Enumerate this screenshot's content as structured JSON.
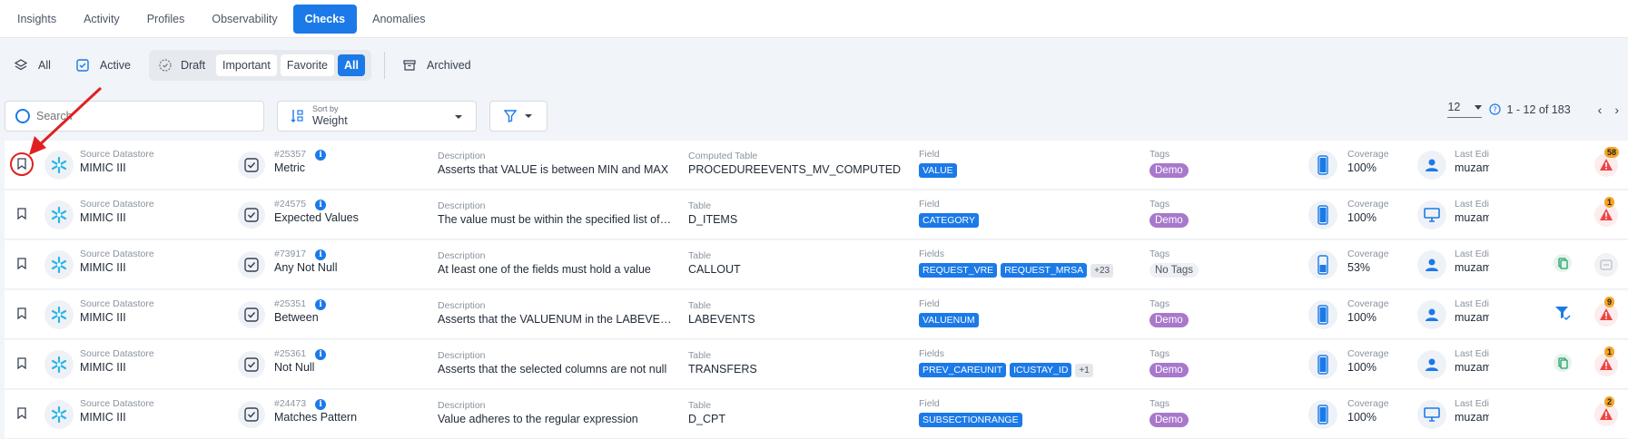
{
  "tabs": [
    {
      "label": "Insights"
    },
    {
      "label": "Activity"
    },
    {
      "label": "Profiles"
    },
    {
      "label": "Observability"
    },
    {
      "label": "Checks",
      "active": true
    },
    {
      "label": "Anomalies"
    }
  ],
  "filters": {
    "all": "All",
    "active": "Active",
    "draft": "Draft",
    "important": "Important",
    "favorite": "Favorite",
    "all_pill": "All",
    "archived": "Archived"
  },
  "search": {
    "placeholder": "Search"
  },
  "sort": {
    "label": "Sort by",
    "value": "Weight"
  },
  "pager": {
    "per_page": "12",
    "range": "1 - 12 of 183"
  },
  "columns": {
    "source": "Source Datastore",
    "description": "Description",
    "tags": "Tags",
    "coverage": "Coverage",
    "last_edit": "Last Edit"
  },
  "rows": [
    {
      "ds": "MIMIC III",
      "id": "#25357",
      "rule": "Metric",
      "desc": "Asserts that VALUE is between MIN and MAX",
      "tbl_label": "Computed Table",
      "tbl": "PROCEDUREEVENTS_MV_COMPUTED",
      "field_label": "Field",
      "fields": [
        "VALUE"
      ],
      "more": "",
      "tag": "Demo",
      "coverage": "100%",
      "coverage_level": 1.0,
      "editor": "muzam",
      "alert_count": "58",
      "alert_type": "warning",
      "editor_icon": "user-icon"
    },
    {
      "ds": "MIMIC III",
      "id": "#24575",
      "rule": "Expected Values",
      "desc": "The value must be within the specified list of values",
      "tbl_label": "Table",
      "tbl": "D_ITEMS",
      "field_label": "Field",
      "fields": [
        "CATEGORY"
      ],
      "more": "",
      "tag": "Demo",
      "coverage": "100%",
      "coverage_level": 1.0,
      "editor": "muzam",
      "alert_count": "1",
      "alert_type": "warning",
      "editor_icon": "monitor-icon"
    },
    {
      "ds": "MIMIC III",
      "id": "#73917",
      "rule": "Any Not Null",
      "desc": "At least one of the fields must hold a value",
      "tbl_label": "Table",
      "tbl": "CALLOUT",
      "field_label": "Fields",
      "fields": [
        "REQUEST_VRE",
        "REQUEST_MRSA"
      ],
      "more": "+23",
      "tag": "No Tags",
      "coverage": "53%",
      "coverage_level": 0.53,
      "editor": "muzam",
      "alert_count": "",
      "alert_type": "none",
      "editor_icon": "user-icon"
    },
    {
      "ds": "MIMIC III",
      "id": "#25351",
      "rule": "Between",
      "desc": "Asserts that the VALUENUM in the LABEVENTS table is within range",
      "tbl_label": "Table",
      "tbl": "LABEVENTS",
      "field_label": "Field",
      "fields": [
        "VALUENUM"
      ],
      "more": "",
      "tag": "Demo",
      "coverage": "100%",
      "coverage_level": 1.0,
      "editor": "muzam",
      "alert_count": "9",
      "alert_type": "warning",
      "editor_icon": "user-icon"
    },
    {
      "ds": "MIMIC III",
      "id": "#25361",
      "rule": "Not Null",
      "desc": "Asserts that the selected columns are not null",
      "tbl_label": "Table",
      "tbl": "TRANSFERS",
      "field_label": "Fields",
      "fields": [
        "PREV_CAREUNIT",
        "ICUSTAY_ID"
      ],
      "more": "+1",
      "tag": "Demo",
      "coverage": "100%",
      "coverage_level": 1.0,
      "editor": "muzam",
      "alert_count": "1",
      "alert_type": "warning",
      "editor_icon": "user-icon"
    },
    {
      "ds": "MIMIC III",
      "id": "#24473",
      "rule": "Matches Pattern",
      "desc": "Value adheres to the regular expression",
      "tbl_label": "Table",
      "tbl": "D_CPT",
      "field_label": "Field",
      "fields": [
        "SUBSECTIONRANGE"
      ],
      "more": "",
      "tag": "Demo",
      "coverage": "100%",
      "coverage_level": 1.0,
      "editor": "muzam",
      "alert_count": "2",
      "alert_type": "warning",
      "editor_icon": "monitor-icon"
    }
  ],
  "colors": {
    "accent": "#1b7ae8",
    "tag": "#a878cc",
    "alert": "#ef4444",
    "annotation": "#e02020"
  }
}
